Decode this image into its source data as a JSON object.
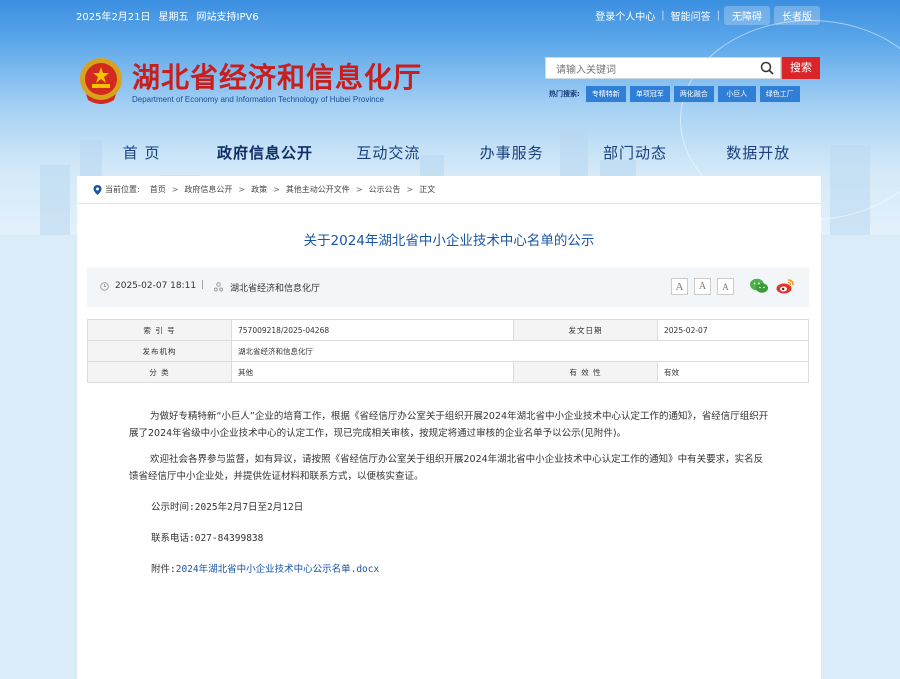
{
  "topbar": {
    "date": "2025年2月21日",
    "weekday": "星期五",
    "ipv6": "网站支持IPV6",
    "login": "登录个人中心",
    "qa": "智能问答",
    "accessible": "无障碍",
    "elder": "长者版"
  },
  "header": {
    "title": "湖北省经济和信息化厅",
    "subtitle": "Department of Economy and Information Technology of Hubei Province"
  },
  "search": {
    "placeholder": "请输入关键词",
    "button": "搜索",
    "hot_label": "热门搜索:",
    "hot_tags": [
      "专精特新",
      "单项冠军",
      "两化融合",
      "小巨人",
      "绿色工厂"
    ]
  },
  "nav": [
    "首 页",
    "政府信息公开",
    "互动交流",
    "办事服务",
    "部门动态",
    "数据开放"
  ],
  "breadcrumb": {
    "label": "当前位置:",
    "items": [
      "首页",
      "政府信息公开",
      "政策",
      "其他主动公开文件",
      "公示公告",
      "正文"
    ]
  },
  "article": {
    "title": "关于2024年湖北省中小企业技术中心名单的公示",
    "date": "2025-02-07 18:11",
    "separator": "|",
    "source": "湖北省经济和信息化厅",
    "font_buttons": [
      "A",
      "A",
      "A"
    ]
  },
  "info": {
    "index_label": "索 引 号",
    "index_value": "757009218/2025-04268",
    "issue_date_label": "发文日期",
    "issue_date_value": "2025-02-07",
    "publisher_label": "发布机构",
    "publisher_value": "湖北省经济和信息化厅",
    "category_label": "分 类",
    "category_value": "其他",
    "validity_label": "有 效 性",
    "validity_value": "有效"
  },
  "body": {
    "p1": "为做好专精特新“小巨人”企业的培育工作，根据《省经信厅办公室关于组织开展2024年湖北省中小企业技术中心认定工作的通知》，省经信厅组织开展了2024年省级中小企业技术中心的认定工作，现已完成相关审核，按规定将通过审核的企业名单予以公示(见附件)。",
    "p2": "欢迎社会各界参与监督，如有异议，请按照《省经信厅办公室关于组织开展2024年湖北省中小企业技术中心认定工作的通知》中有关要求，实名反馈省经信厅中小企业处，并提供佐证材料和联系方式，以便核实查证。",
    "period": "公示时间:2025年2月7日至2月12日",
    "phone": "联系电话:027-84399838",
    "attach_label": "附件:",
    "attach_link": "2024年湖北省中小企业技术中心公示名单.docx"
  },
  "colors": {
    "accent_red": "#d9252a",
    "title_blue": "#1a56a8",
    "nav_blue": "#1a3f7c"
  }
}
